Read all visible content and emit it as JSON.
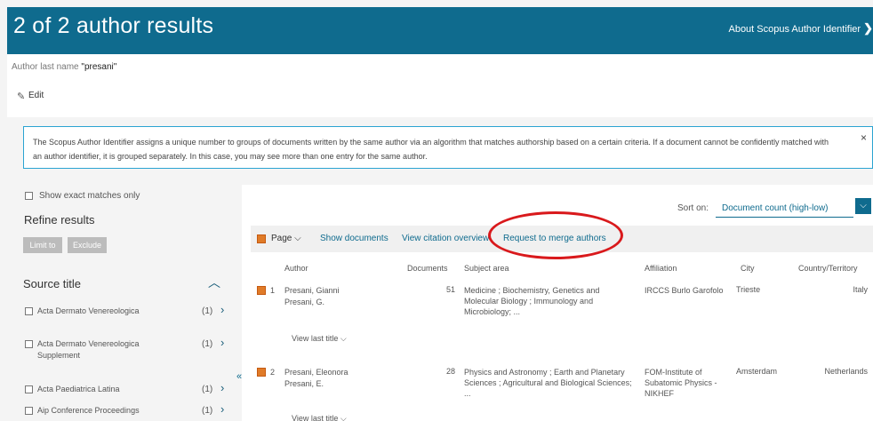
{
  "header": {
    "title": "2 of 2 author results",
    "about_link": "About Scopus Author Identifier",
    "about_chevron": "❯"
  },
  "query": {
    "label": "Author last name",
    "value": "\"presani\"",
    "edit_label": "Edit"
  },
  "banner": {
    "text": "The Scopus Author Identifier assigns a unique number to groups of documents written by the same author via an algorithm that matches authorship based on a certain criteria. If a document cannot be confidently matched with an author identifier, it is grouped separately. In this case, you may see more than one entry for the same author.",
    "close": "×"
  },
  "sidebar": {
    "exact_matches": "Show exact matches only",
    "refine_title": "Refine results",
    "limit_to": "Limit to",
    "exclude": "Exclude",
    "source_title": "Source title",
    "sources": [
      {
        "label": "Acta Dermato Venereologica",
        "count": "(1)"
      },
      {
        "label": "Acta Dermato Venereologica Supplement",
        "count": "(1)"
      },
      {
        "label": "Acta Paediatrica Latina",
        "count": "(1)"
      },
      {
        "label": "Aip Conference Proceedings",
        "count": "(1)"
      }
    ]
  },
  "results": {
    "sort_label": "Sort on:",
    "sort_value": "Document count (high-low)",
    "toolbar": {
      "page": "Page ⌵",
      "show_documents": "Show documents",
      "view_citation": "View citation overview",
      "merge": "Request to merge authors"
    },
    "columns": [
      "Author",
      "Documents",
      "Subject area",
      "Affiliation",
      "City",
      "Country/Territory"
    ],
    "rows": [
      {
        "num": "1",
        "author": "Presani, Gianni",
        "alt": "Presani, G.",
        "documents": "51",
        "subject": "Medicine ; Biochemistry, Genetics and Molecular Biology ; Immunology and Microbiology; ...",
        "affiliation": "IRCCS Burlo Garofolo",
        "city": "Trieste",
        "country": "Italy"
      },
      {
        "num": "2",
        "author": "Presani, Eleonora",
        "alt": "Presani, E.",
        "documents": "28",
        "subject": "Physics and Astronomy ; Earth and Planetary Sciences ; Agricultural and Biological Sciences; ...",
        "affiliation": "FOM-Institute of Subatomic Physics - NIKHEF",
        "city": "Amsterdam",
        "country": "Netherlands"
      }
    ],
    "view_last_title": "View last title ⌵"
  },
  "colors": {
    "header_bg": "#0f6b8e",
    "accent": "#0f6b8e",
    "highlight_circle": "#d9191c",
    "checkbox_orange": "#e07b28"
  }
}
